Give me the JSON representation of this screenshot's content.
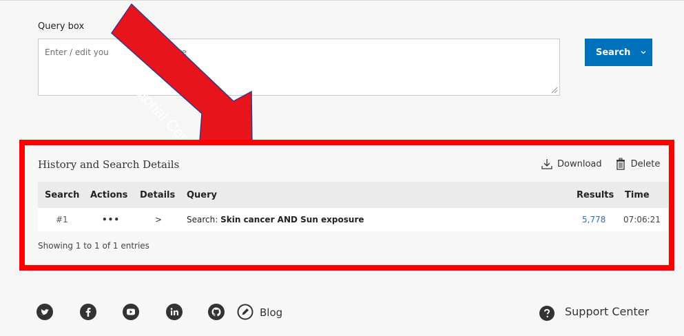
{
  "query": {
    "label": "Query box",
    "placeholder": "Enter / edit your search query here",
    "visible_text": "Enter / edit you",
    "visible_text_tail": "here",
    "search_label": "Search"
  },
  "annotation": {
    "text": "Historial Cerca",
    "color": "#e8141b"
  },
  "history": {
    "title": "History and Search Details",
    "download_label": "Download",
    "delete_label": "Delete",
    "columns": [
      "Search",
      "Actions",
      "Details",
      "Query",
      "Results",
      "Time"
    ],
    "rows": [
      {
        "number": "#1",
        "actions": "•••",
        "details": ">",
        "query_prefix": "Search:",
        "query_text": "Skin cancer AND Sun exposure",
        "results": "5,778",
        "time": "07:06:21"
      }
    ],
    "showing": "Showing 1 to 1 of 1 entries"
  },
  "footer": {
    "icons": [
      "twitter-icon",
      "facebook-icon",
      "youtube-icon",
      "linkedin-icon",
      "github-icon",
      "blog-icon"
    ],
    "blog_label": "Blog",
    "support_label": "Support Center"
  },
  "colors": {
    "accent": "#0071bc",
    "highlight_frame": "#ff0000",
    "link": "#2f6fb5"
  }
}
